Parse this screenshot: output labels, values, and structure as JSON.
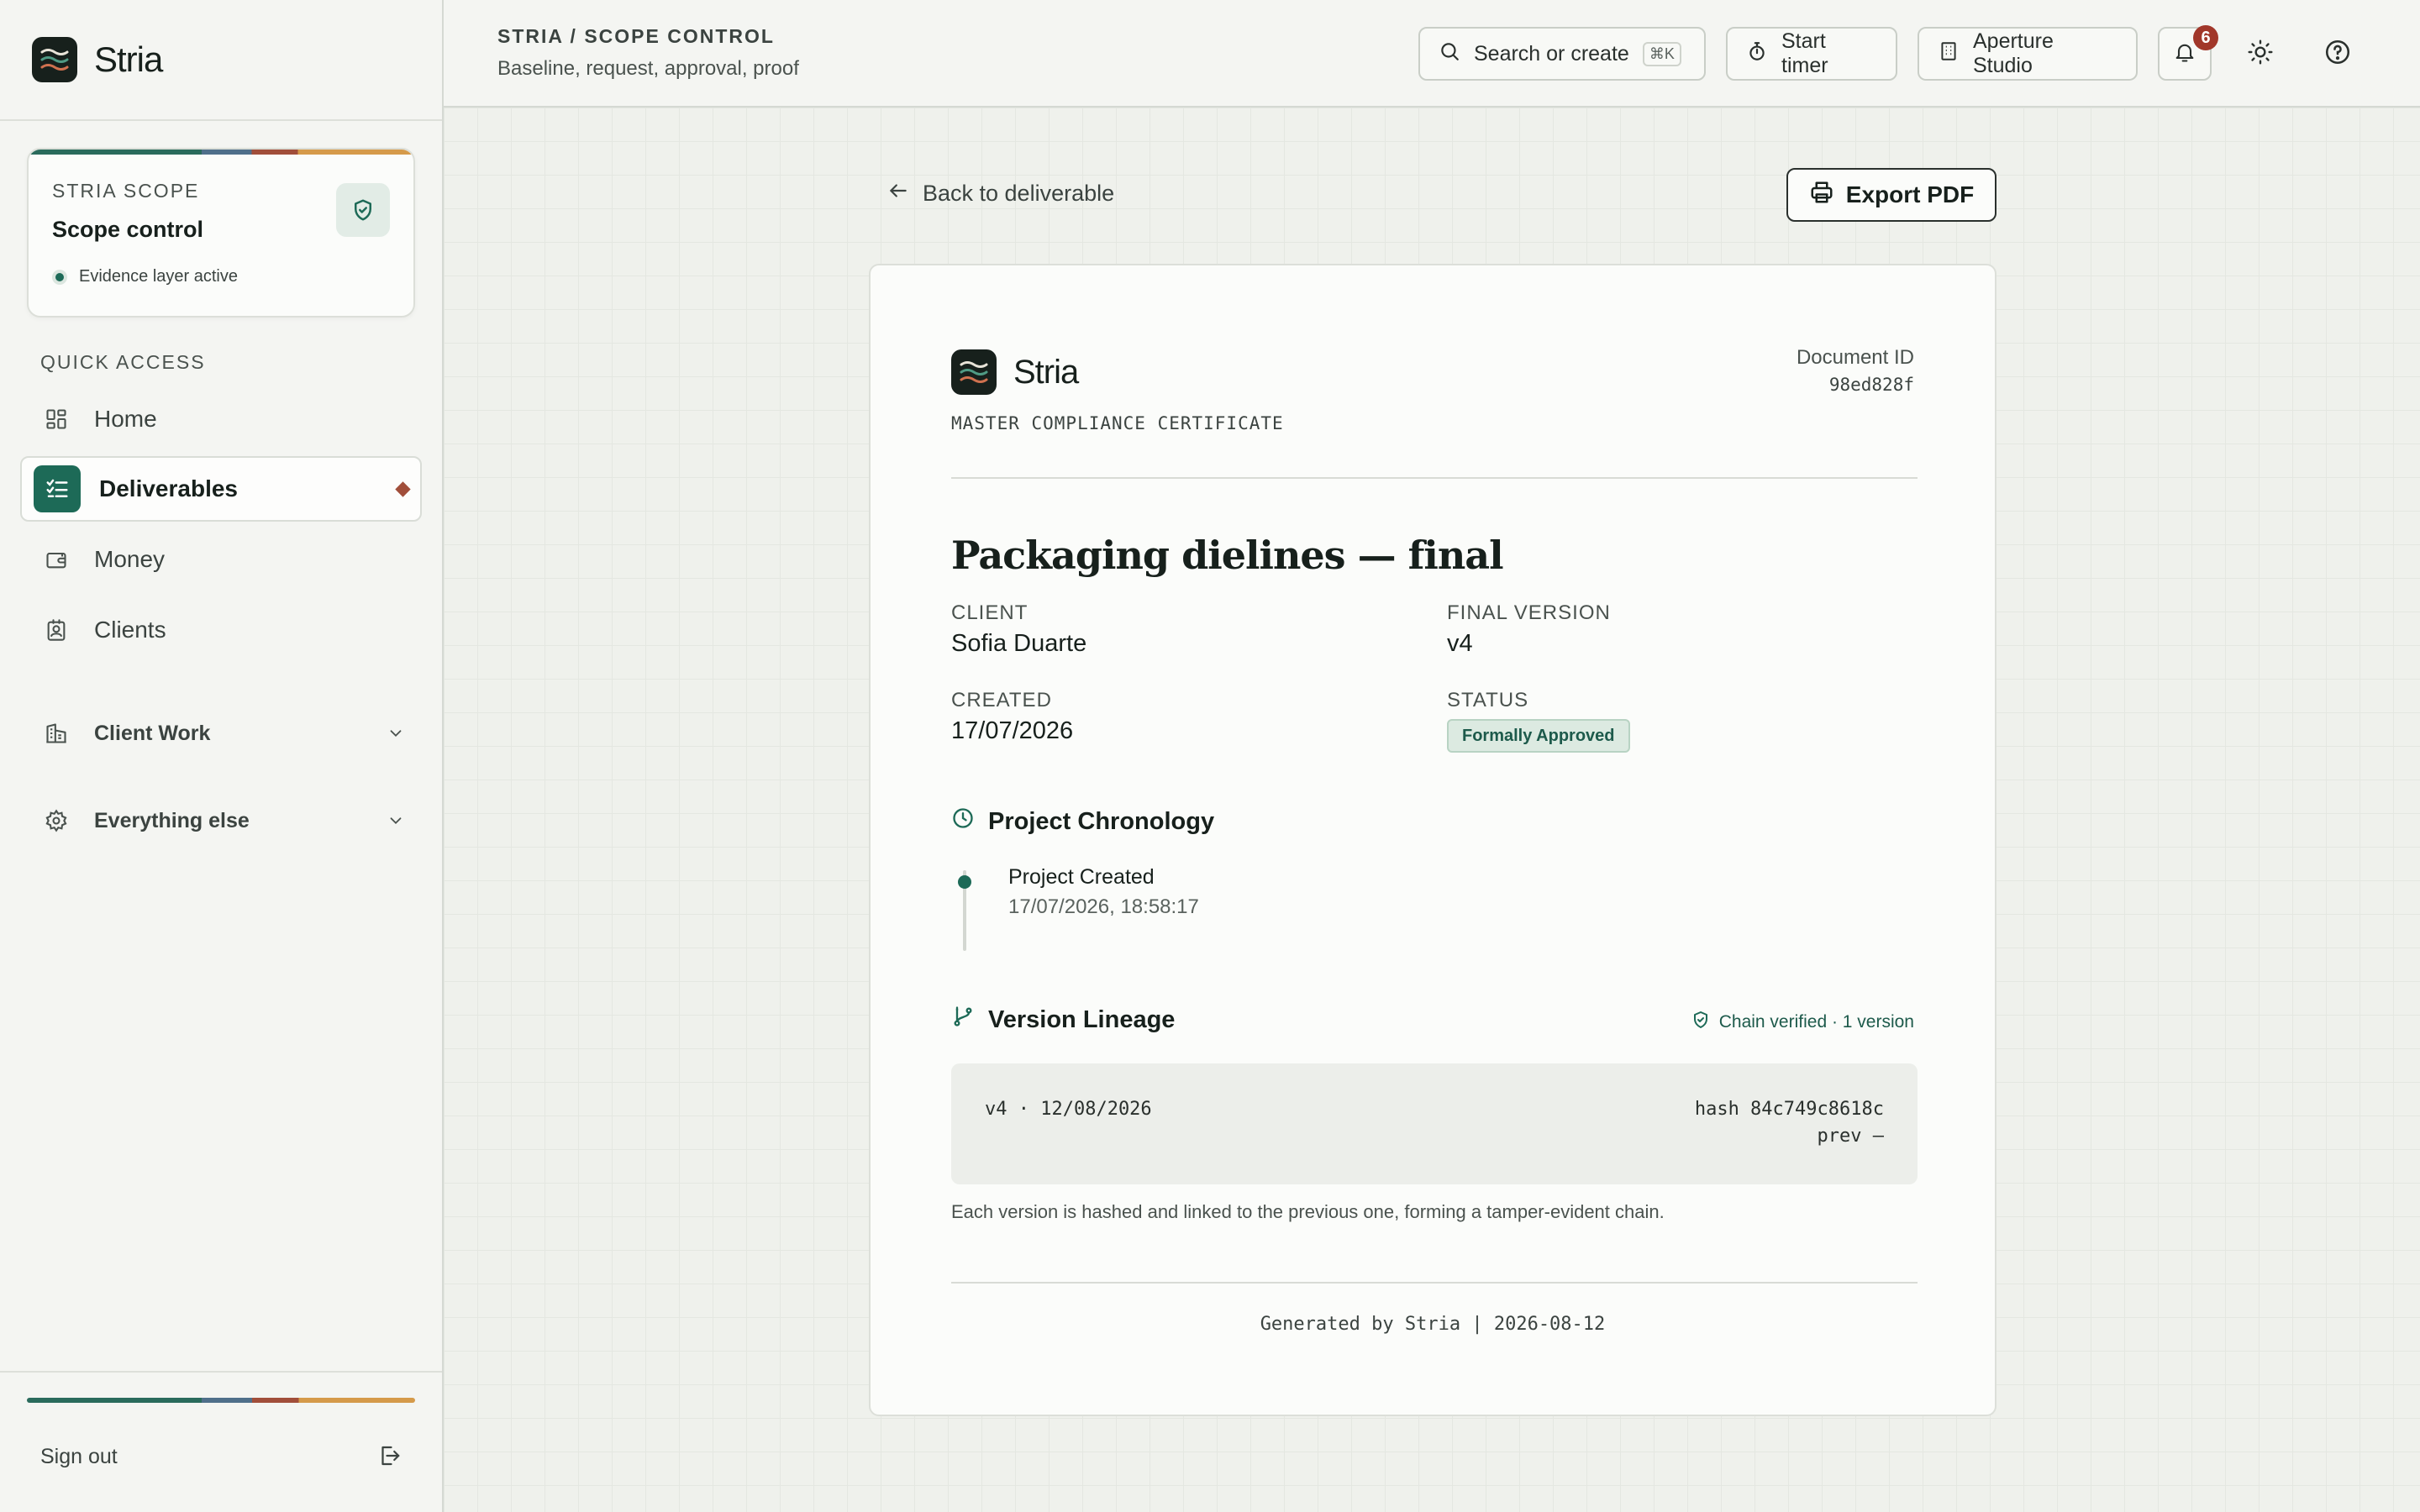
{
  "app": {
    "name": "Stria"
  },
  "sidebar": {
    "scope_card": {
      "kicker": "STRIA SCOPE",
      "title": "Scope control",
      "status": "Evidence layer active"
    },
    "quick_access_label": "QUICK ACCESS",
    "nav": [
      {
        "label": "Home",
        "icon": "grid-icon",
        "active": false
      },
      {
        "label": "Deliverables",
        "icon": "checklist-icon",
        "active": true
      },
      {
        "label": "Money",
        "icon": "wallet-icon",
        "active": false
      },
      {
        "label": "Clients",
        "icon": "contact-card-icon",
        "active": false
      }
    ],
    "groups": [
      {
        "label": "Client Work",
        "icon": "building-icon"
      },
      {
        "label": "Everything else",
        "icon": "gear-icon"
      }
    ],
    "sign_out": "Sign out"
  },
  "topbar": {
    "breadcrumb": "STRIA / SCOPE CONTROL",
    "subtitle": "Baseline, request, approval, proof",
    "search_label": "Search or create",
    "search_shortcut": "⌘K",
    "timer_label": "Start timer",
    "workspace_label": "Aperture Studio",
    "notification_count": "6"
  },
  "main": {
    "back_label": "Back to deliverable",
    "export_label": "Export PDF"
  },
  "certificate": {
    "brand": "Stria",
    "kicker": "MASTER COMPLIANCE CERTIFICATE",
    "document_id_label": "Document ID",
    "document_id": "98ed828f",
    "title": "Packaging dielines — final",
    "fields": {
      "client_label": "CLIENT",
      "client": "Sofia Duarte",
      "final_version_label": "FINAL VERSION",
      "final_version": "v4",
      "created_label": "CREATED",
      "created": "17/07/2026",
      "status_label": "STATUS",
      "status": "Formally Approved"
    },
    "chronology": {
      "heading": "Project Chronology",
      "events": [
        {
          "title": "Project Created",
          "time": "17/07/2026, 18:58:17"
        }
      ]
    },
    "lineage": {
      "heading": "Version Lineage",
      "chain_status": "Chain verified · 1 version",
      "versions": [
        {
          "label": "v4 · 12/08/2026",
          "hash": "hash 84c749c8618c",
          "prev": "prev —"
        }
      ],
      "note": "Each version is hashed and linked to the previous one, forming a tamper-evident chain."
    },
    "footer": "Generated by Stria | 2026-08-12"
  },
  "colors": {
    "accent": "#1d6a57",
    "danger": "#a14e3a",
    "ink": "#17201c"
  }
}
